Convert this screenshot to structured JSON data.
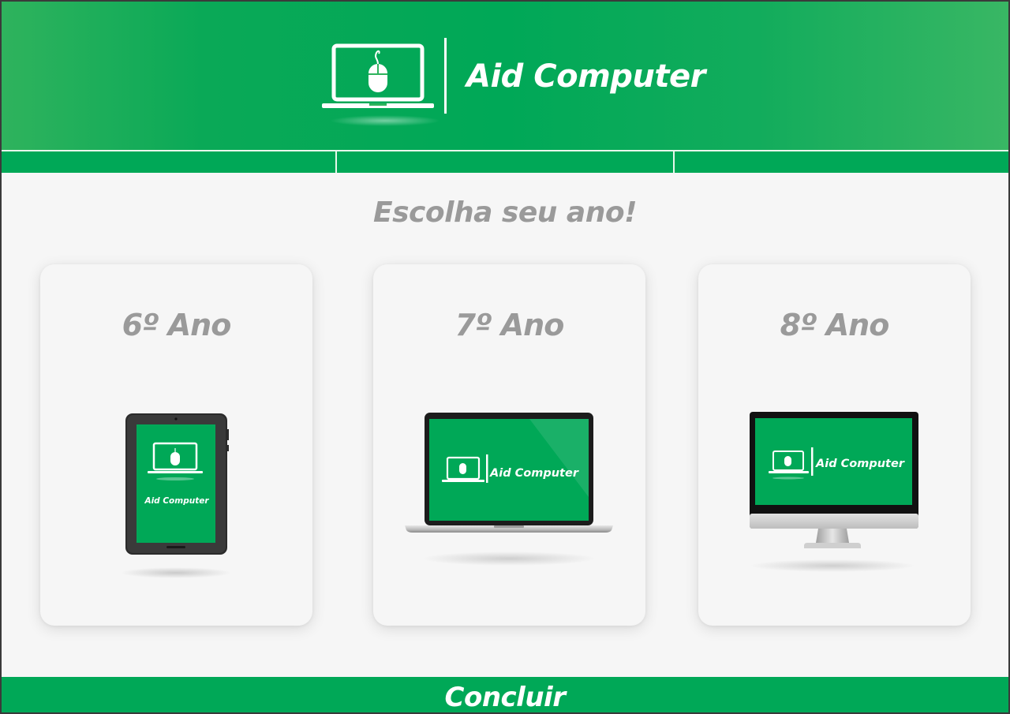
{
  "app": {
    "title": "Aid Computer"
  },
  "nav": {
    "tabs": [
      "",
      "",
      ""
    ]
  },
  "main": {
    "heading": "Escolha seu ano!"
  },
  "cards": [
    {
      "title": "6º Ano",
      "device": "tablet-icon",
      "screen_label": "Aid Computer"
    },
    {
      "title": "7º Ano",
      "device": "laptop-icon",
      "screen_label": "Aid Computer"
    },
    {
      "title": "8º Ano",
      "device": "desktop-monitor-icon",
      "screen_label": "Aid Computer"
    }
  ],
  "footer": {
    "button_label": "Concluir"
  },
  "colors": {
    "brand_green": "#00a857",
    "heading_gray": "#9a9a9a",
    "background": "#f6f6f6"
  }
}
